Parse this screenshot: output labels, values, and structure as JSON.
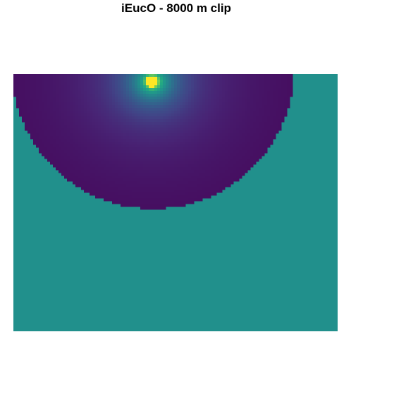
{
  "chart_data": {
    "type": "heatmap",
    "title": "iEucO - 8000 m clip",
    "xlabel": "",
    "ylabel": "",
    "grid": false,
    "legend": "none",
    "colormap": "viridis",
    "background_value_color": "#21908C",
    "inside_low_color": "#440154",
    "peak_color": "#FDE725",
    "clip_shape": "half-disc",
    "clip_radius_m": 8000
  }
}
